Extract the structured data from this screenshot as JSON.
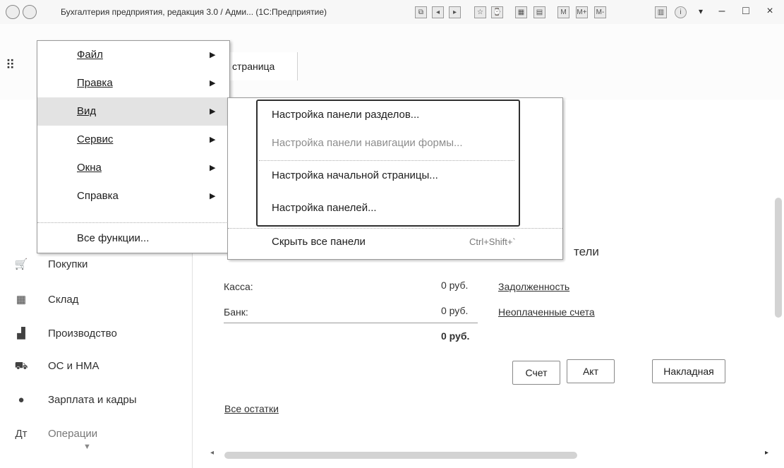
{
  "window": {
    "title": "Бухгалтерия предприятия, редакция 3.0 / Адми... (1С:Предприятие)",
    "controls": [
      "–",
      "□",
      "×"
    ]
  },
  "toolbar": {
    "home_tab": "страница"
  },
  "menu": {
    "items": [
      {
        "label": "Файл",
        "arrow": "▶"
      },
      {
        "label": "Правка",
        "arrow": "▶"
      },
      {
        "label": "Вид",
        "arrow": "▶"
      },
      {
        "label": "Сервис",
        "arrow": "▶"
      },
      {
        "label": "Окна",
        "arrow": "▶"
      },
      {
        "label": "Справка",
        "arrow": "▶"
      }
    ],
    "all_functions": "Все функции..."
  },
  "submenu": {
    "items": [
      "Настройка панели разделов...",
      "Настройка панели навигации формы...",
      "Настройка начальной страницы...",
      "Настройка панелей..."
    ],
    "hide_all": "Скрыть все панели",
    "hide_all_shortcut": "Ctrl+Shift+`"
  },
  "sidebar": {
    "items": [
      {
        "label": "Покупки",
        "icon": "cart-icon"
      },
      {
        "label": "Склад",
        "icon": "warehouse-icon"
      },
      {
        "label": "Производство",
        "icon": "factory-icon"
      },
      {
        "label": "ОС и НМА",
        "icon": "truck-icon"
      },
      {
        "label": "Зарплата и кадры",
        "icon": "person-icon"
      },
      {
        "label": "Операции",
        "icon": "operations-icon"
      }
    ]
  },
  "content": {
    "partial_heading": "тели",
    "kassa_label": "Касса:",
    "kassa_value": "0 руб.",
    "bank_label": "Банк:",
    "bank_value": "0 руб.",
    "total_value": "0 руб.",
    "debt_link": "Задолженность",
    "unpaid_link": "Неоплаченные счета",
    "all_balances_link": "Все остатки",
    "btn_invoice": "Счет",
    "btn_act": "Акт",
    "btn_waybill": "Накладная"
  }
}
